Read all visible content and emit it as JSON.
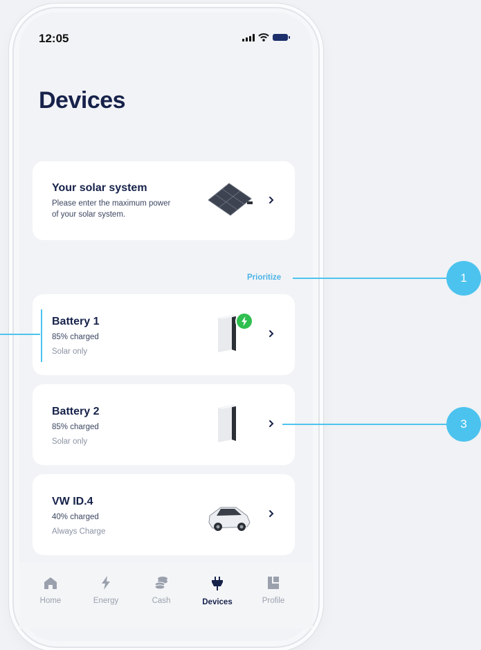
{
  "status_bar": {
    "time": "12:05"
  },
  "page": {
    "title": "Devices"
  },
  "solar_card": {
    "title": "Your solar system",
    "subtitle_line1": "Please enter the maximum power",
    "subtitle_line2": "of your solar system."
  },
  "prioritize_label": "Prioritize",
  "devices": [
    {
      "name": "Battery 1",
      "charge": "85% charged",
      "mode": "Solar only",
      "charging": true
    },
    {
      "name": "Battery 2",
      "charge": "85% charged",
      "mode": "Solar only",
      "charging": false
    },
    {
      "name": "VW ID.4",
      "charge": "40% charged",
      "mode": "Always Charge",
      "charging": false
    }
  ],
  "tabs": [
    {
      "label": "Home",
      "icon": "home-icon",
      "active": false
    },
    {
      "label": "Energy",
      "icon": "lightning-icon",
      "active": false
    },
    {
      "label": "Cash",
      "icon": "coins-icon",
      "active": false
    },
    {
      "label": "Devices",
      "icon": "plug-icon",
      "active": true
    },
    {
      "label": "Profile",
      "icon": "profile-icon",
      "active": false
    }
  ],
  "annotations": [
    "1",
    "3"
  ],
  "colors": {
    "accent": "#4cc3ee",
    "title_navy": "#16224a",
    "charging_green": "#2fbf4f",
    "inactive_tab": "#9aa1ad"
  }
}
